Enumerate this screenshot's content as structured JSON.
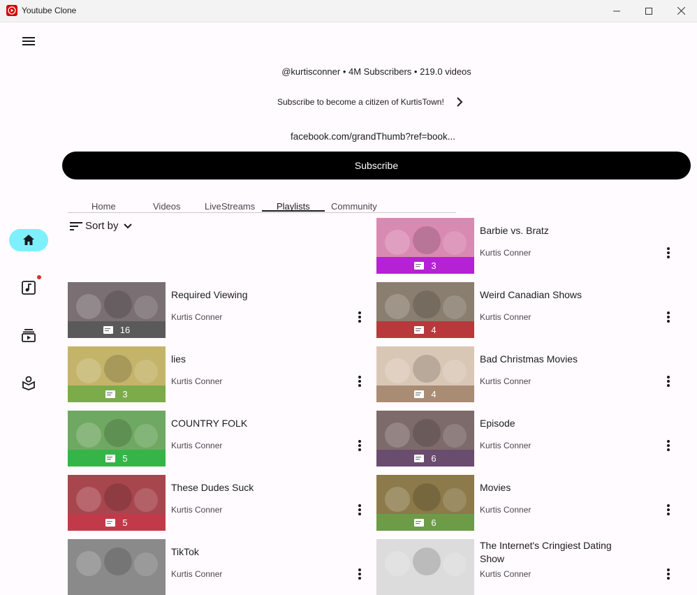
{
  "window": {
    "title": "Youtube Clone",
    "icon": "youtube-icon"
  },
  "channel": {
    "meta": "@kurtisconner • 4M Subscribers • 219.0 videos",
    "description": "Subscribe to become a citizen of KurtisTown!",
    "link": "facebook.com/grandThumb?ref=book...",
    "subscribe_label": "Subscribe"
  },
  "tabs": [
    {
      "label": "Home"
    },
    {
      "label": "Videos"
    },
    {
      "label": "LiveStreams"
    },
    {
      "label": "Playlists",
      "active": true
    },
    {
      "label": "Community"
    }
  ],
  "sort": {
    "label": "Sort by"
  },
  "nav": [
    {
      "icon": "home-icon",
      "active": true
    },
    {
      "icon": "music-library-icon",
      "badge": true
    },
    {
      "icon": "subscriptions-icon"
    },
    {
      "icon": "library-icon"
    }
  ],
  "playlists": [
    {
      "title": "Barbie vs. Bratz",
      "author": "Kurtis Conner",
      "count": "3",
      "band": "#b522d4",
      "bg": "#d98ab2"
    },
    {
      "title": "Required Viewing",
      "author": "Kurtis Conner",
      "count": "16",
      "band": "#5a5a5a",
      "bg": "#7a6f73"
    },
    {
      "title": "Weird Canadian Shows",
      "author": "Kurtis Conner",
      "count": "4",
      "band": "#b8383c",
      "bg": "#8a7e70"
    },
    {
      "title": "lies",
      "author": "Kurtis Conner",
      "count": "3",
      "band": "#7cab4a",
      "bg": "#c4b46a"
    },
    {
      "title": "Bad Christmas Movies",
      "author": "Kurtis Conner",
      "count": "4",
      "band": "#a98c74",
      "bg": "#d9c7b6"
    },
    {
      "title": "COUNTRY FOLK",
      "author": "Kurtis Conner",
      "count": "5",
      "band": "#35b548",
      "bg": "#6fa862"
    },
    {
      "title": "Episode",
      "author": "Kurtis Conner",
      "count": "6",
      "band": "#6a4c6e",
      "bg": "#7d6a6a"
    },
    {
      "title": "These Dudes Suck",
      "author": "Kurtis Conner",
      "count": "5",
      "band": "#c23a4a",
      "bg": "#a8464e"
    },
    {
      "title": "Movies",
      "author": "Kurtis Conner",
      "count": "6",
      "band": "#6c9c48",
      "bg": "#8c7a4a"
    },
    {
      "title": "TikTok",
      "author": "Kurtis Conner",
      "count": "",
      "band": "#555555",
      "bg": "#8a8a8a"
    },
    {
      "title": "The Internet's Cringiest Dating Show",
      "author": "Kurtis Conner",
      "count": "",
      "band": "#bdbdbd",
      "bg": "#dcdcdc"
    }
  ]
}
